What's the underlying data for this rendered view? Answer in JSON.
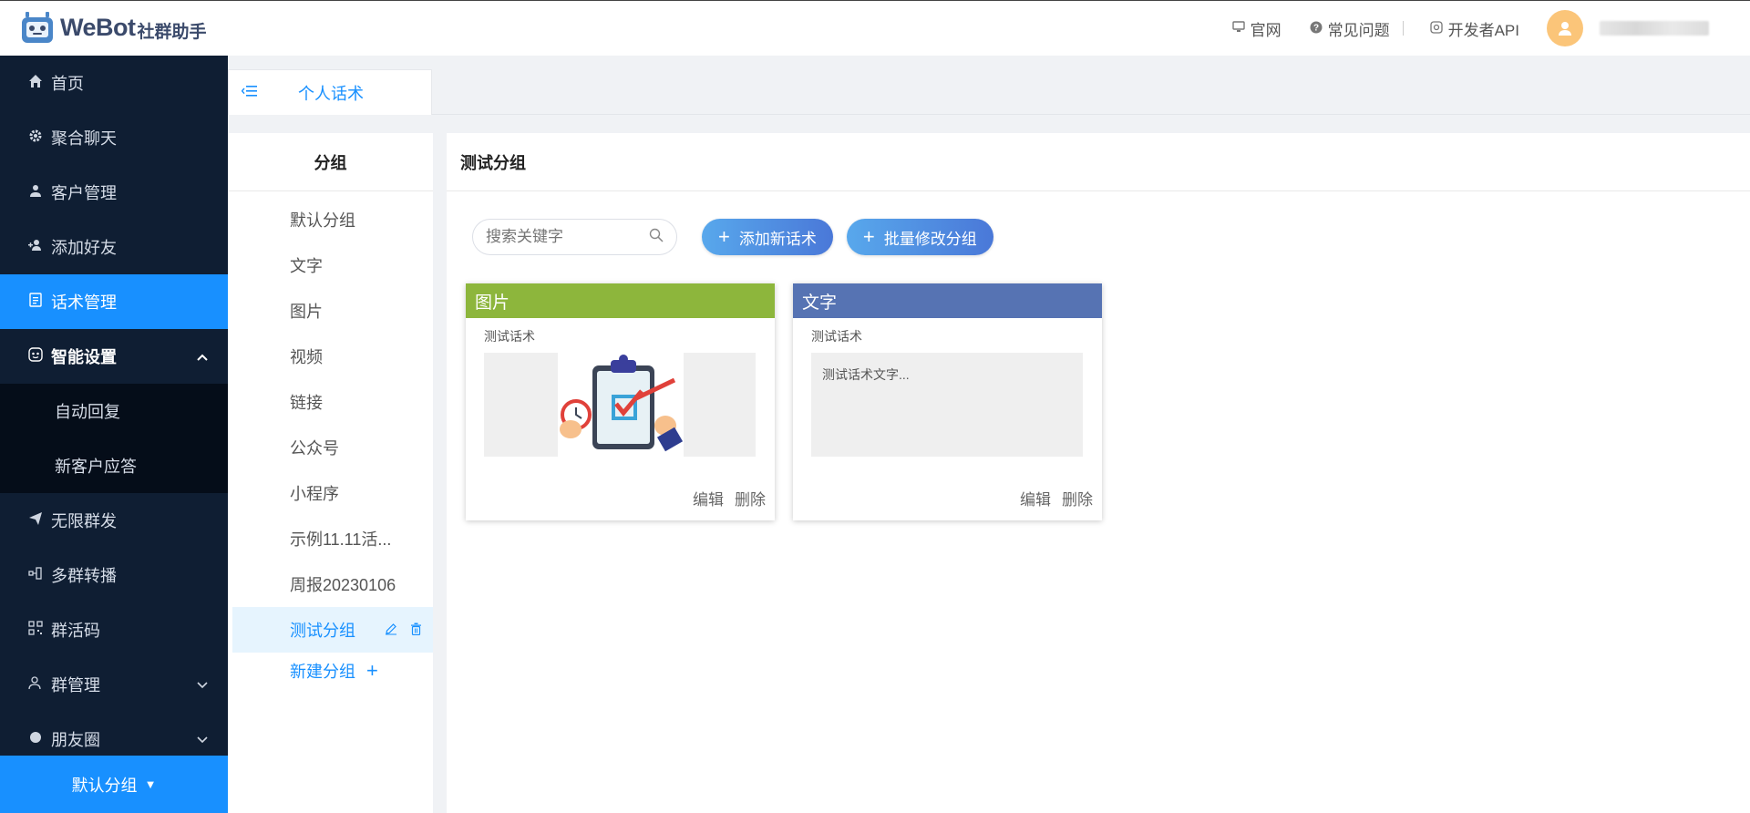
{
  "app": {
    "logo_text": "WeBot",
    "logo_sub": "社群助手"
  },
  "topbar": {
    "links": [
      {
        "label": "官网",
        "icon": "monitor-icon"
      },
      {
        "label": "常见问题",
        "icon": "help-circle-icon"
      },
      {
        "label": "开发者API",
        "icon": "api-icon"
      }
    ],
    "avatar_icon": "user-icon"
  },
  "sidebar": {
    "items": [
      {
        "label": "首页",
        "icon": "home-icon"
      },
      {
        "label": "聚合聊天",
        "icon": "gear-icon"
      },
      {
        "label": "客户管理",
        "icon": "user-icon"
      },
      {
        "label": "添加好友",
        "icon": "add-user-icon"
      },
      {
        "label": "话术管理",
        "icon": "document-icon",
        "active": true
      },
      {
        "label": "智能设置",
        "icon": "smart-icon",
        "expanded": true
      }
    ],
    "subitems": [
      "自动回复",
      "新客户应答"
    ],
    "items2": [
      {
        "label": "无限群发",
        "icon": "send-icon"
      },
      {
        "label": "多群转播",
        "icon": "broadcast-icon"
      },
      {
        "label": "群活码",
        "icon": "qrcode-icon"
      },
      {
        "label": "群管理",
        "icon": "group-icon"
      },
      {
        "label": "朋友圈",
        "icon": "moments-icon"
      }
    ],
    "bottom_label": "默认分组"
  },
  "tabs": [
    {
      "label": "个人话术",
      "active": true
    }
  ],
  "groups": {
    "header": "分组",
    "items": [
      "默认分组",
      "文字",
      "图片",
      "视频",
      "链接",
      "公众号",
      "小程序",
      "示例11.11活...",
      "周报20230106",
      "测试分组"
    ],
    "active_index": 9,
    "new_label": "新建分组"
  },
  "main": {
    "title": "测试分组",
    "search_placeholder": "搜索关键字",
    "add_button": "添加新话术",
    "batch_button": "批量修改分组",
    "cards": [
      {
        "type": "图片",
        "color": "#8db63c",
        "name": "测试话术",
        "preview": "",
        "edit": "编辑",
        "delete": "删除"
      },
      {
        "type": "文字",
        "color": "#5673b3",
        "name": "测试话术",
        "preview": "测试话术文字...",
        "edit": "编辑",
        "delete": "删除"
      }
    ]
  }
}
